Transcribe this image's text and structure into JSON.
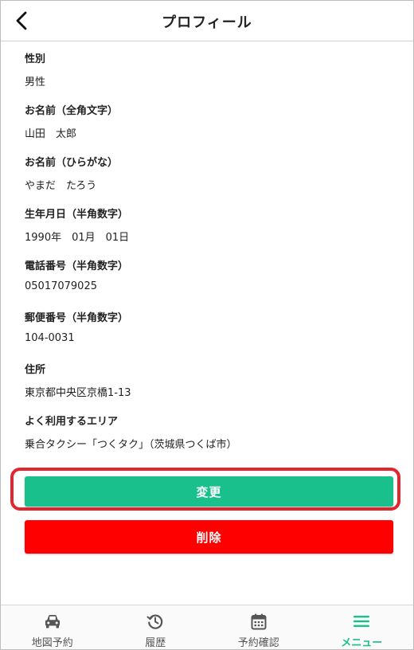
{
  "header": {
    "title": "プロフィール",
    "back_icon": "chevron-left-icon"
  },
  "profile": {
    "fields": [
      {
        "label": "性別",
        "value": "男性"
      },
      {
        "label": "お名前（全角文字）",
        "value": "山田　太郎"
      },
      {
        "label": "お名前（ひらがな）",
        "value": "やまだ　たろう"
      },
      {
        "label": "生年月日（半角数字）",
        "value": "1990年　01月　01日"
      },
      {
        "label": "電話番号（半角数字）",
        "value": "05017079025"
      },
      {
        "label": "郵便番号（半角数字）",
        "value": "104-0031"
      },
      {
        "label": "住所",
        "value": "東京都中央区京橋1-13"
      },
      {
        "label": "よく利用するエリア",
        "value": "乗合タクシー「つくタク」（茨城県つくば市）"
      }
    ]
  },
  "actions": {
    "change_label": "変更",
    "delete_label": "削除"
  },
  "nav": {
    "items": [
      {
        "label": "地図予約",
        "icon": "car-icon"
      },
      {
        "label": "履歴",
        "icon": "history-icon"
      },
      {
        "label": "予約確認",
        "icon": "calendar-icon"
      },
      {
        "label": "メニュー",
        "icon": "menu-icon"
      }
    ],
    "active_index": 3
  },
  "colors": {
    "primary": "#19c08c",
    "danger": "#ff0000",
    "highlight": "#e2262e"
  }
}
